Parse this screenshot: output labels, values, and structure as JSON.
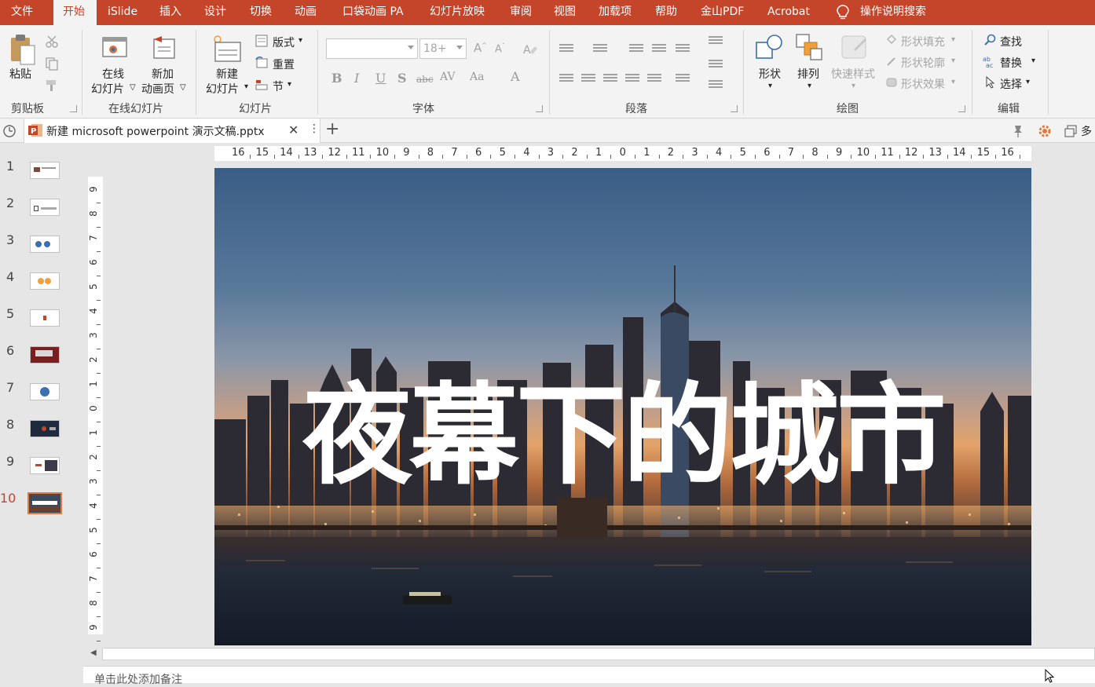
{
  "menu": {
    "tabs": [
      "文件",
      "开始",
      "iSlide",
      "插入",
      "设计",
      "切换",
      "动画",
      "口袋动画 PA",
      "幻灯片放映",
      "审阅",
      "视图",
      "加载项",
      "帮助",
      "金山PDF",
      "Acrobat"
    ],
    "active_tab": "开始",
    "search_label": "操作说明搜索"
  },
  "ribbon": {
    "clipboard": {
      "paste": "粘贴",
      "group": "剪贴板"
    },
    "online_slides": {
      "online": "在线",
      "online2": "幻灯片",
      "new_anim": "新加",
      "new_anim2": "动画页",
      "group": "在线幻灯片"
    },
    "slides": {
      "new_slide": "新建",
      "new_slide2": "幻灯片",
      "layout": "版式",
      "reset": "重置",
      "section": "节",
      "group": "幻灯片"
    },
    "font": {
      "font_name": "",
      "font_size_placeholder": "18+",
      "group": "字体"
    },
    "paragraph": {
      "group": "段落"
    },
    "drawing": {
      "shapes": "形状",
      "arrange": "排列",
      "quick_styles": "快速样式",
      "shape_fill": "形状填充",
      "shape_outline": "形状轮廓",
      "shape_effects": "形状效果",
      "group": "绘图"
    },
    "editing": {
      "find": "查找",
      "replace": "替换",
      "select": "选择",
      "group": "编辑"
    }
  },
  "document": {
    "tab_title": "新建 microsoft powerpoint 演示文稿.pptx",
    "right_label": "多"
  },
  "slides_panel": {
    "numbers": [
      "1",
      "2",
      "3",
      "4",
      "5",
      "6",
      "7",
      "8",
      "9",
      "10"
    ],
    "current": "10"
  },
  "ruler": {
    "h_labels": [
      "16",
      "15",
      "14",
      "13",
      "12",
      "11",
      "10",
      "9",
      "8",
      "7",
      "6",
      "5",
      "4",
      "3",
      "2",
      "1",
      "0",
      "1",
      "2",
      "3",
      "4",
      "5",
      "6",
      "7",
      "8",
      "9",
      "10",
      "11",
      "12",
      "13",
      "14",
      "15",
      "16"
    ],
    "v_labels": [
      "9",
      "8",
      "7",
      "6",
      "5",
      "4",
      "3",
      "2",
      "1",
      "0",
      "1",
      "2",
      "3",
      "4",
      "5",
      "6",
      "7",
      "8",
      "9"
    ]
  },
  "slide": {
    "title": "夜幕下的城市"
  },
  "notes": {
    "placeholder": "单击此处添加备注"
  },
  "colors": {
    "accent": "#c4452a",
    "ribbon_bg": "#f3f3f3",
    "current_thumb_border": "#e07a3f"
  }
}
